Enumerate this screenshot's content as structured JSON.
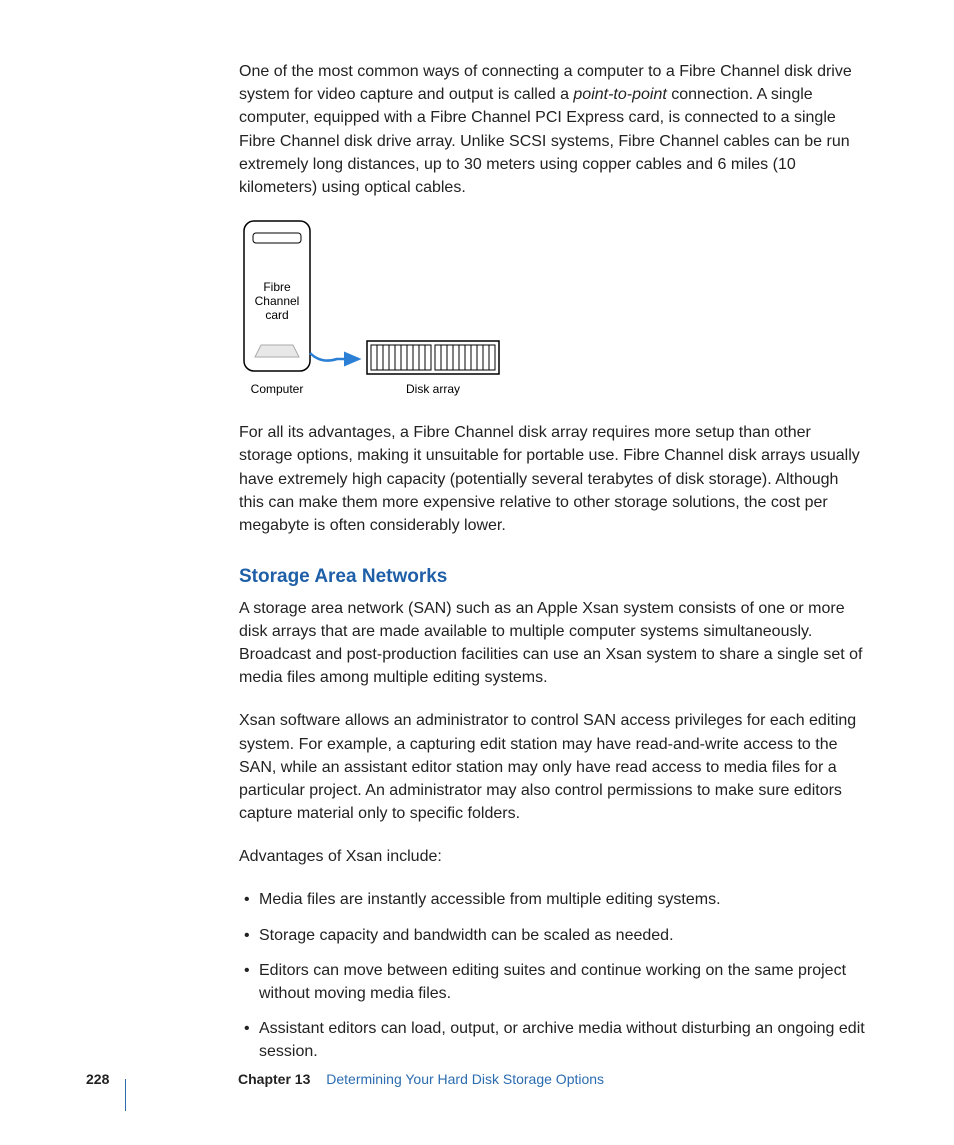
{
  "para1_a": "One of the most common ways of connecting a computer to a Fibre Channel disk drive system for video capture and output is called a ",
  "para1_em": "point-to-point",
  "para1_b": " connection. A single computer, equipped with a Fibre Channel PCI Express card, is connected to a single Fibre Channel disk drive array. Unlike SCSI systems, Fibre Channel cables can be run extremely long distances, up to 30 meters using copper cables and 6 miles (10 kilometers) using optical cables.",
  "diagram": {
    "card_l1": "Fibre",
    "card_l2": "Channel",
    "card_l3": "card",
    "label_computer": "Computer",
    "label_diskarray": "Disk array"
  },
  "para2": "For all its advantages, a Fibre Channel disk array requires more setup than other storage options, making it unsuitable for portable use. Fibre Channel disk arrays usually have extremely high capacity (potentially several terabytes of disk storage). Although this can make them more expensive relative to other storage solutions, the cost per megabyte is often considerably lower.",
  "heading": "Storage Area Networks",
  "para3": "A storage area network (SAN) such as an Apple Xsan system consists of one or more disk arrays that are made available to multiple computer systems simultaneously. Broadcast and post-production facilities can use an Xsan system to share a single set of media files among multiple editing systems.",
  "para4": "Xsan software allows an administrator to control SAN access privileges for each editing system. For example, a capturing edit station may have read-and-write access to the SAN, while an assistant editor station may only have read access to media files for a particular project. An administrator may also control permissions to make sure editors capture material only to specific folders.",
  "para5": "Advantages of Xsan include:",
  "bullets": {
    "b1": "Media files are instantly accessible from multiple editing systems.",
    "b2": "Storage capacity and bandwidth can be scaled as needed.",
    "b3": "Editors can move between editing suites and continue working on the same project without moving media files.",
    "b4": "Assistant editors can load, output, or archive media without disturbing an ongoing edit session."
  },
  "footer": {
    "page": "228",
    "chapter_label": "Chapter 13",
    "chapter_title": "Determining Your Hard Disk Storage Options"
  }
}
